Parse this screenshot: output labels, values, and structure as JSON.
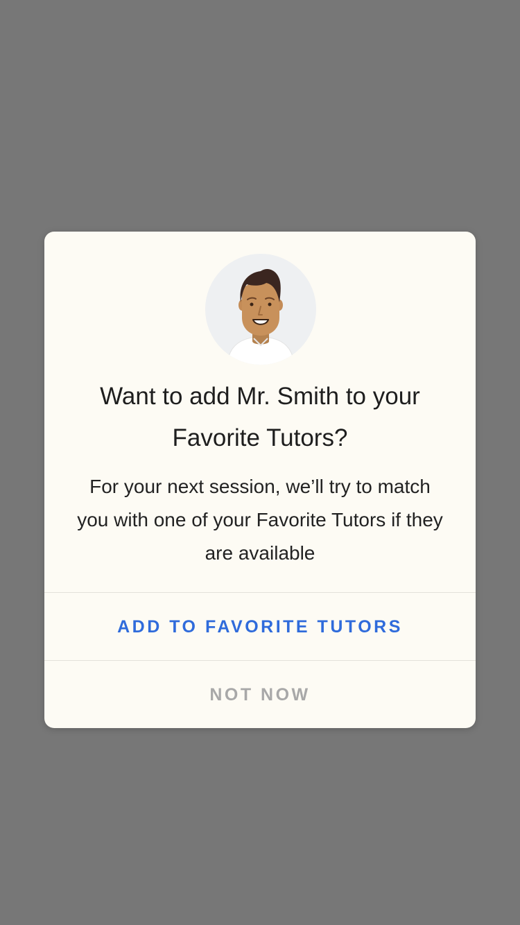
{
  "overlay": {
    "background_color": "#777777"
  },
  "dialog": {
    "background_color": "#fdfbf4",
    "avatar": {
      "icon": "tutor-avatar-icon",
      "description": "Cartoon tutor portrait"
    },
    "title": "Want to add Mr. Smith to your Favorite Tutors?",
    "message": "For your next session, we’ll try to match you with one of your Favorite Tutors if they are available",
    "primary_action": {
      "label": "ADD TO FAVORITE TUTORS",
      "color": "#2f6bdb"
    },
    "secondary_action": {
      "label": "NOT NOW",
      "color": "#a8a8a8"
    }
  }
}
